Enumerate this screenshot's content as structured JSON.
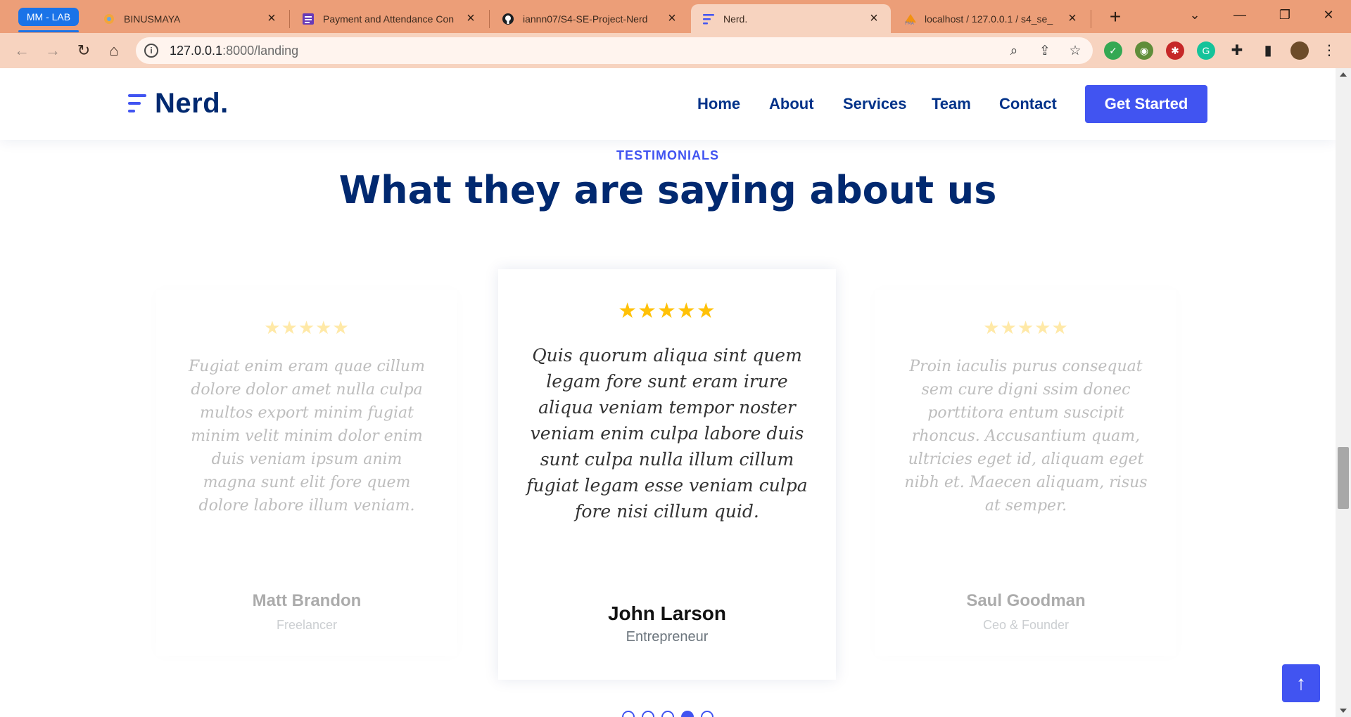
{
  "browser": {
    "tab_group": "MM - LAB",
    "tabs": [
      {
        "title": "BINUSMAYA",
        "favicon": "binusmaya-icon"
      },
      {
        "title": "Payment and Attendance Con",
        "favicon": "forms-icon"
      },
      {
        "title": "iannn07/S4-SE-Project-Nerd",
        "favicon": "github-icon"
      },
      {
        "title": "Nerd.",
        "favicon": "nerd-icon",
        "active": true
      },
      {
        "title": "localhost / 127.0.0.1 / s4_se_",
        "favicon": "phpmyadmin-icon"
      }
    ],
    "address": {
      "host": "127.0.0.1",
      "rest": ":8000/landing"
    }
  },
  "nav": {
    "logo": "Nerd.",
    "items": [
      "Home",
      "About",
      "Services",
      "Team",
      "Contact"
    ],
    "cta": "Get Started"
  },
  "section": {
    "label": "TESTIMONIALS",
    "title": "What they are saying about us"
  },
  "testimonials": [
    {
      "stars": "★★★★★",
      "quote": "Fugiat enim eram quae cillum dolore dolor amet nulla culpa multos export minim fugiat minim velit minim dolor enim duis veniam ipsum anim magna sunt elit fore quem dolore labore illum veniam.",
      "name": "Matt Brandon",
      "role": "Freelancer"
    },
    {
      "stars": "★★★★★",
      "quote": "Quis quorum aliqua sint quem legam fore sunt eram irure aliqua veniam tempor noster veniam enim culpa labore duis sunt culpa nulla illum cillum fugiat legam esse veniam culpa fore nisi cillum quid.",
      "name": "John Larson",
      "role": "Entrepreneur"
    },
    {
      "stars": "★★★★★",
      "quote": "Proin iaculis purus consequat sem cure digni ssim donec porttitora entum suscipit rhoncus. Accusantium quam, ultricies eget id, aliquam eget nibh et. Maecen aliquam, risus at semper.",
      "name": "Saul Goodman",
      "role": "Ceo & Founder"
    }
  ],
  "pagination": {
    "count": 5,
    "active_index": 3
  },
  "colors": {
    "accent": "#4154f1",
    "navy": "#012970",
    "star": "#ffc107",
    "chrome": "#ec9e78"
  }
}
